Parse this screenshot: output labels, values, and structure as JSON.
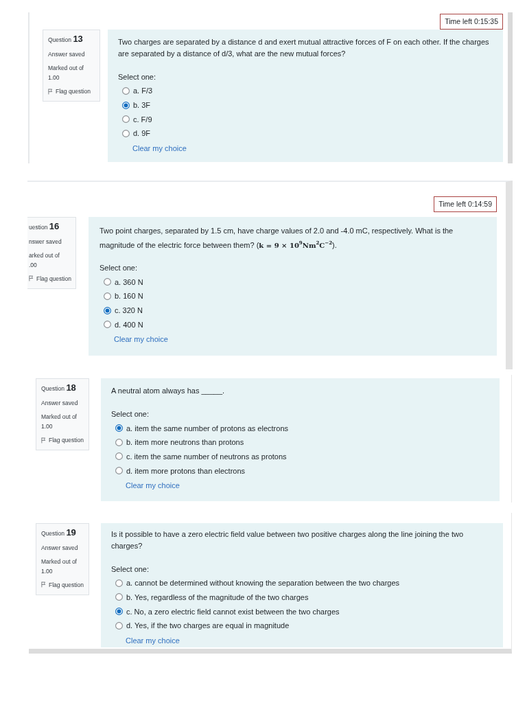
{
  "screenshots": [
    {
      "timer": "Time left 0:15:35",
      "info": {
        "question": "Question **13**",
        "status": "Answer saved",
        "marks_label": "Marked out of",
        "marks": "1.00",
        "flag": "Flag question"
      },
      "question": "Two charges are separated by a distance d and exert mutual attractive forces of F on each other. If the charges are separated by a distance of d/3, what are the new mutual forces?",
      "prompt": "Select one:",
      "options": [
        {
          "text": "a. F/3",
          "selected": false
        },
        {
          "text": "b. 3F",
          "selected": true
        },
        {
          "text": "c. F/9",
          "selected": false
        },
        {
          "text": "d. 9F",
          "selected": false
        }
      ],
      "clear_link": "Clear my choice"
    },
    {
      "timer": "Time left 0:14:59",
      "info": {
        "question": "uestion **16**",
        "status": "nswer saved",
        "marks_label": "arked out of",
        "marks": ".00",
        "flag": "Flag question"
      },
      "question": "Two point charges, separated by 1.5 cm, have charge values of 2.0 and -4.0 mC, respectively. What is the magnitude of the electric force between them? (**k = 9 × 10**$^{9}$**Nm**$^{2}$**C**$^{−2}$).",
      "prompt": "Select one:",
      "options": [
        {
          "text": "a. 360 N",
          "selected": false
        },
        {
          "text": "b. 160 N",
          "selected": false
        },
        {
          "text": "c. 320 N",
          "selected": true
        },
        {
          "text": "d. 400 N",
          "selected": false
        }
      ],
      "clear_link": "Clear my choice"
    },
    {
      "info": {
        "question": "Question **18**",
        "status": "Answer saved",
        "marks_label": "Marked out of",
        "marks": "1.00",
        "flag": "Flag question"
      },
      "question": "A neutral atom always has _____.",
      "prompt": "Select one:",
      "options": [
        {
          "text": "a. item the same number of protons as electrons",
          "selected": true
        },
        {
          "text": "b. item more neutrons than protons",
          "selected": false
        },
        {
          "text": "c. item the same number of neutrons as protons",
          "selected": false
        },
        {
          "text": "d. item more protons than electrons",
          "selected": false
        }
      ],
      "clear_link": "Clear my choice"
    },
    {
      "info": {
        "question": "Question **19**",
        "status": "Answer saved",
        "marks_label": "Marked out of",
        "marks": "1.00",
        "flag": "Flag question"
      },
      "question": "Is it possible to have a zero electric field value between two positive charges along the line joining the two charges?",
      "prompt": "Select one:",
      "options": [
        {
          "text": "a. cannot be determined without knowing the separation between the two charges",
          "selected": false
        },
        {
          "text": "b. Yes, regardless of the magnitude of the two charges",
          "selected": false
        },
        {
          "text": "c. No, a zero electric field cannot exist between the two charges",
          "selected": true
        },
        {
          "text": "d. Yes, if the two charges are equal in magnitude",
          "selected": false
        }
      ],
      "clear_link": "Clear my choice"
    }
  ]
}
